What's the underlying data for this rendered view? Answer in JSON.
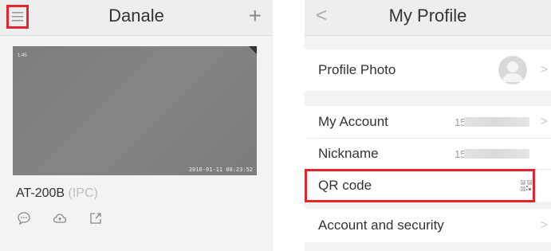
{
  "left": {
    "header": {
      "title": "Danale",
      "menu_icon": "hamburger-menu-icon",
      "add_icon": "plus-icon"
    },
    "camera": {
      "time_overlay": "1:45",
      "stamp": "2016-01-11 08:23:52"
    },
    "device": {
      "name": "AT-200B",
      "type": "(IPC)"
    },
    "actions": [
      "message-icon",
      "cloud-icon",
      "share-icon"
    ],
    "highlight_color": "#e3262e"
  },
  "right": {
    "header": {
      "title": "My Profile",
      "back_label": "<"
    },
    "rows": [
      {
        "label": "Profile Photo"
      },
      {
        "label": "My Account",
        "value": "151"
      },
      {
        "label": "Nickname",
        "value": "151"
      },
      {
        "label": "QR code"
      },
      {
        "label": "Account and security"
      }
    ],
    "chevron": ">"
  }
}
